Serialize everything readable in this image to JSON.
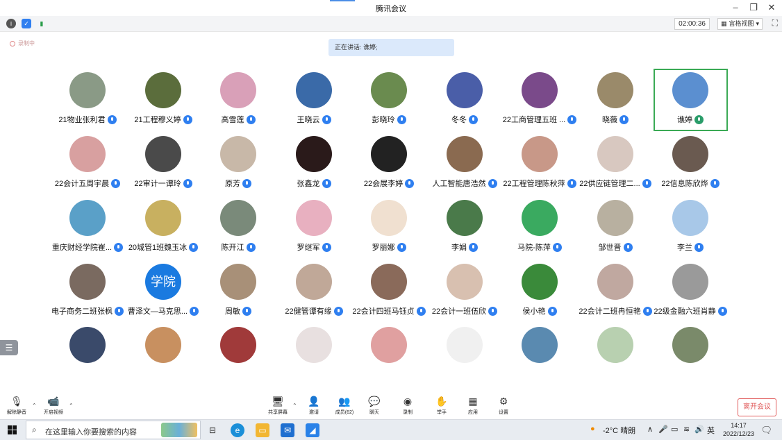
{
  "window": {
    "title": "腾讯会议"
  },
  "toolbar": {
    "timer": "02:00:36",
    "view_label": "宫格视图"
  },
  "recording": {
    "label": "录制中"
  },
  "speaking": {
    "text": "正在讲话: 谯婷;"
  },
  "participants": [
    {
      "name": "21物业张利君",
      "bg": "#8a9a86"
    },
    {
      "name": "21工程穆义婷",
      "bg": "#5b6d3c"
    },
    {
      "name": "高雪莲",
      "bg": "#d9a0b8"
    },
    {
      "name": "王晓云",
      "bg": "#3a6aa8"
    },
    {
      "name": "彭晓玲",
      "bg": "#6a8b4f"
    },
    {
      "name": "冬冬",
      "bg": "#4a5ea8"
    },
    {
      "name": "22工商管理五班 ...",
      "bg": "#7a4a8a"
    },
    {
      "name": "晓薇",
      "bg": "#9a8a6a"
    },
    {
      "name": "谯婷",
      "bg": "#5b8fd0",
      "active": true
    },
    {
      "name": "22会计五周宇晨",
      "bg": "#d8a0a0"
    },
    {
      "name": "22审计一谭玲",
      "bg": "#4a4a4a"
    },
    {
      "name": "原芳",
      "bg": "#c8b8a8"
    },
    {
      "name": "张鑫龙",
      "bg": "#2a1a1a"
    },
    {
      "name": "22会展李婷",
      "bg": "#222222"
    },
    {
      "name": "人工智能唐浩然",
      "bg": "#8a6a50"
    },
    {
      "name": "22工程管理陈秋萍",
      "bg": "#c89888"
    },
    {
      "name": "22供应链管理二...",
      "bg": "#d8c8c0"
    },
    {
      "name": "22信息陈欣烨",
      "bg": "#6a5a50"
    },
    {
      "name": "重庆财经学院崔...",
      "bg": "#5aa0c8"
    },
    {
      "name": "20城管1班魏玉冰",
      "bg": "#c8b060"
    },
    {
      "name": "陈开江",
      "bg": "#7a8a7a"
    },
    {
      "name": "罗继军",
      "bg": "#e8b0c0"
    },
    {
      "name": "罗丽娜",
      "bg": "#f0e0d0"
    },
    {
      "name": "李娟",
      "bg": "#4a7a4a"
    },
    {
      "name": "马院-陈萍",
      "bg": "#3aaa60"
    },
    {
      "name": "邹世晋",
      "bg": "#b8b0a0"
    },
    {
      "name": "李兰",
      "bg": "#a8c8e8"
    },
    {
      "name": "电子商务二班张枫",
      "bg": "#7a6a60"
    },
    {
      "name": "曹泽文—马克思...",
      "bg": "#1a7ae0",
      "initials": "学院"
    },
    {
      "name": "周敏",
      "bg": "#a89078"
    },
    {
      "name": "22健管谭有缘",
      "bg": "#c0a898"
    },
    {
      "name": "22会计四班马钰贞",
      "bg": "#8a6a5a"
    },
    {
      "name": "22会计一班伍欣",
      "bg": "#d8c0b0"
    },
    {
      "name": "侯小艳",
      "bg": "#3a8a3a"
    },
    {
      "name": "22会计二班冉恒艳",
      "bg": "#c0a8a0"
    },
    {
      "name": "22级金融六班肖静",
      "bg": "#9a9a9a"
    },
    {
      "name": "",
      "bg": "#3a4a6a"
    },
    {
      "name": "",
      "bg": "#c89060"
    },
    {
      "name": "",
      "bg": "#a03a3a"
    },
    {
      "name": "",
      "bg": "#e8e0e0"
    },
    {
      "name": "",
      "bg": "#e0a0a0"
    },
    {
      "name": "",
      "bg": "#f0f0f0"
    },
    {
      "name": "",
      "bg": "#5a8ab0"
    },
    {
      "name": "",
      "bg": "#b8d0b0"
    },
    {
      "name": "",
      "bg": "#7a8a6a"
    }
  ],
  "controls": {
    "mute": "解除静音",
    "video": "开启视频",
    "share": "共享屏幕",
    "invite": "邀请",
    "members": "成员(62)",
    "chat": "聊天",
    "record": "录制",
    "raise_hand": "举手",
    "apps": "应用",
    "settings": "设置",
    "leave": "离开会议"
  },
  "taskbar": {
    "search_placeholder": "在这里输入你要搜索的内容",
    "weather": "-2°C 晴朗",
    "ime": "英",
    "time": "14:17",
    "date": "2022/12/23"
  }
}
